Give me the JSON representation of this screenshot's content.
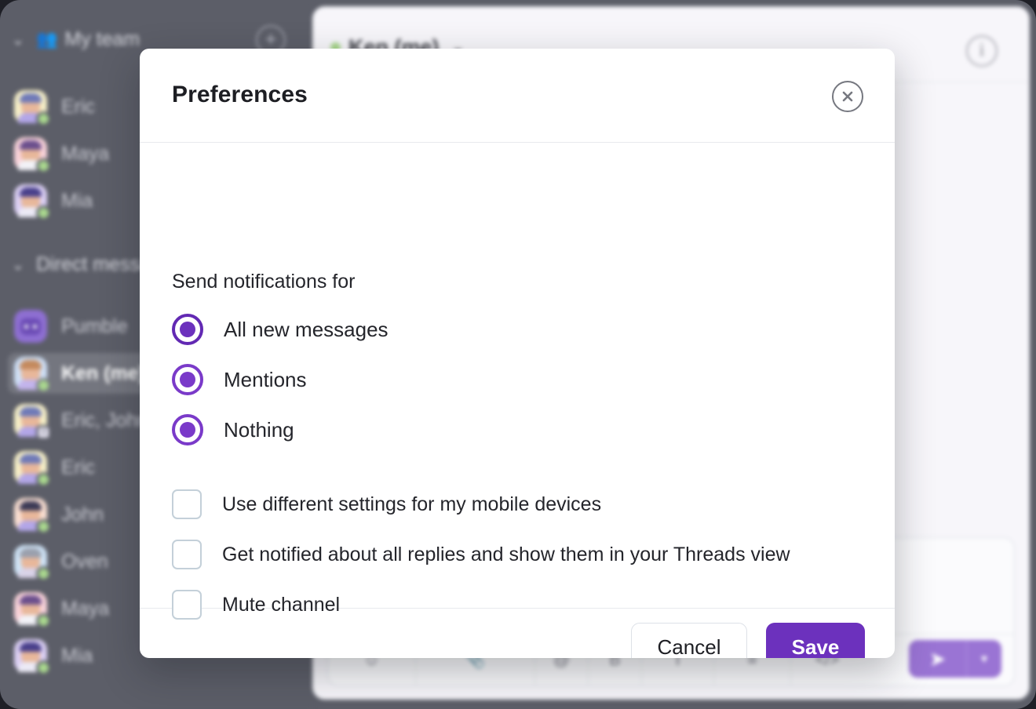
{
  "window": {
    "background_color": "#5c5e68",
    "panel_color": "#f7f6fa"
  },
  "sidebar": {
    "sections": [
      {
        "id": "my-team",
        "chevron": "⌄",
        "icon": "👥",
        "label": "My team",
        "add_label": "+"
      },
      {
        "id": "direct-messages",
        "chevron": "⌄",
        "icon": "",
        "label": "Direct messages",
        "add_label": ""
      }
    ],
    "team_members": [
      {
        "name": "Eric",
        "avatar_bg": "#f7f0c8",
        "hair": "#6f7ab8",
        "presence": "online"
      },
      {
        "name": "Maya",
        "avatar_bg": "#f9d3da",
        "hair": "#6b4f8d",
        "presence": "online"
      },
      {
        "name": "Mia",
        "avatar_bg": "#dcd0f5",
        "hair": "#49408b",
        "presence": "online"
      }
    ],
    "direct_messages": [
      {
        "name": "Pumble",
        "avatar_bg": "#8e6fd2",
        "hair": "#6b4bb5",
        "presence": "none",
        "bot": true,
        "active": false
      },
      {
        "name": "Ken (me)",
        "avatar_bg": "#cfe0f7",
        "hair": "#c48a5e",
        "presence": "online",
        "bot": false,
        "active": true
      },
      {
        "name": "Eric, John",
        "avatar_bg": "#f7f0c8",
        "hair": "#6f7ab8",
        "presence": "badge",
        "badge": "4",
        "bot": false,
        "active": false
      },
      {
        "name": "Eric",
        "avatar_bg": "#f7f0c8",
        "hair": "#6f7ab8",
        "presence": "online",
        "bot": false,
        "active": false
      },
      {
        "name": "John",
        "avatar_bg": "#fadfd2",
        "hair": "#3c3a56",
        "presence": "online",
        "bot": false,
        "active": false
      },
      {
        "name": "Oven",
        "avatar_bg": "#cfe4f7",
        "hair": "#9aa0ad",
        "presence": "online",
        "bot": false,
        "active": false
      },
      {
        "name": "Maya",
        "avatar_bg": "#f9d3da",
        "hair": "#6b4f8d",
        "presence": "online",
        "bot": false,
        "active": false
      },
      {
        "name": "Mia",
        "avatar_bg": "#dcd0f5",
        "hair": "#49408b",
        "presence": "online",
        "bot": false,
        "active": false
      }
    ]
  },
  "chat": {
    "title": "Ken (me)",
    "presence": "online",
    "chevron": "⌄",
    "info_icon_label": "i",
    "composer": {
      "toolbar_icons": [
        "emoji-icon",
        "attach-icon",
        "mention-icon",
        "bold-icon",
        "italic-icon",
        "list-icon",
        "code-icon"
      ],
      "send_icon": "➤",
      "send_more_icon": "▾"
    }
  },
  "modal": {
    "title": "Preferences",
    "close_icon": "close-icon",
    "section_label": "Send notifications for",
    "radio_group": {
      "name": "notifications",
      "options": [
        {
          "label": "All new messages",
          "selected": true
        },
        {
          "label": "Mentions",
          "selected": true
        },
        {
          "label": "Nothing",
          "selected": true
        }
      ]
    },
    "checkboxes": [
      {
        "label": "Use different settings for my mobile devices",
        "checked": false
      },
      {
        "label": "Get notified about all replies and show them in your Threads view",
        "checked": false
      },
      {
        "label": "Mute channel",
        "checked": false
      }
    ],
    "footer": {
      "cancel_label": "Cancel",
      "save_label": "Save"
    },
    "accent_color": "#6c31bd"
  }
}
